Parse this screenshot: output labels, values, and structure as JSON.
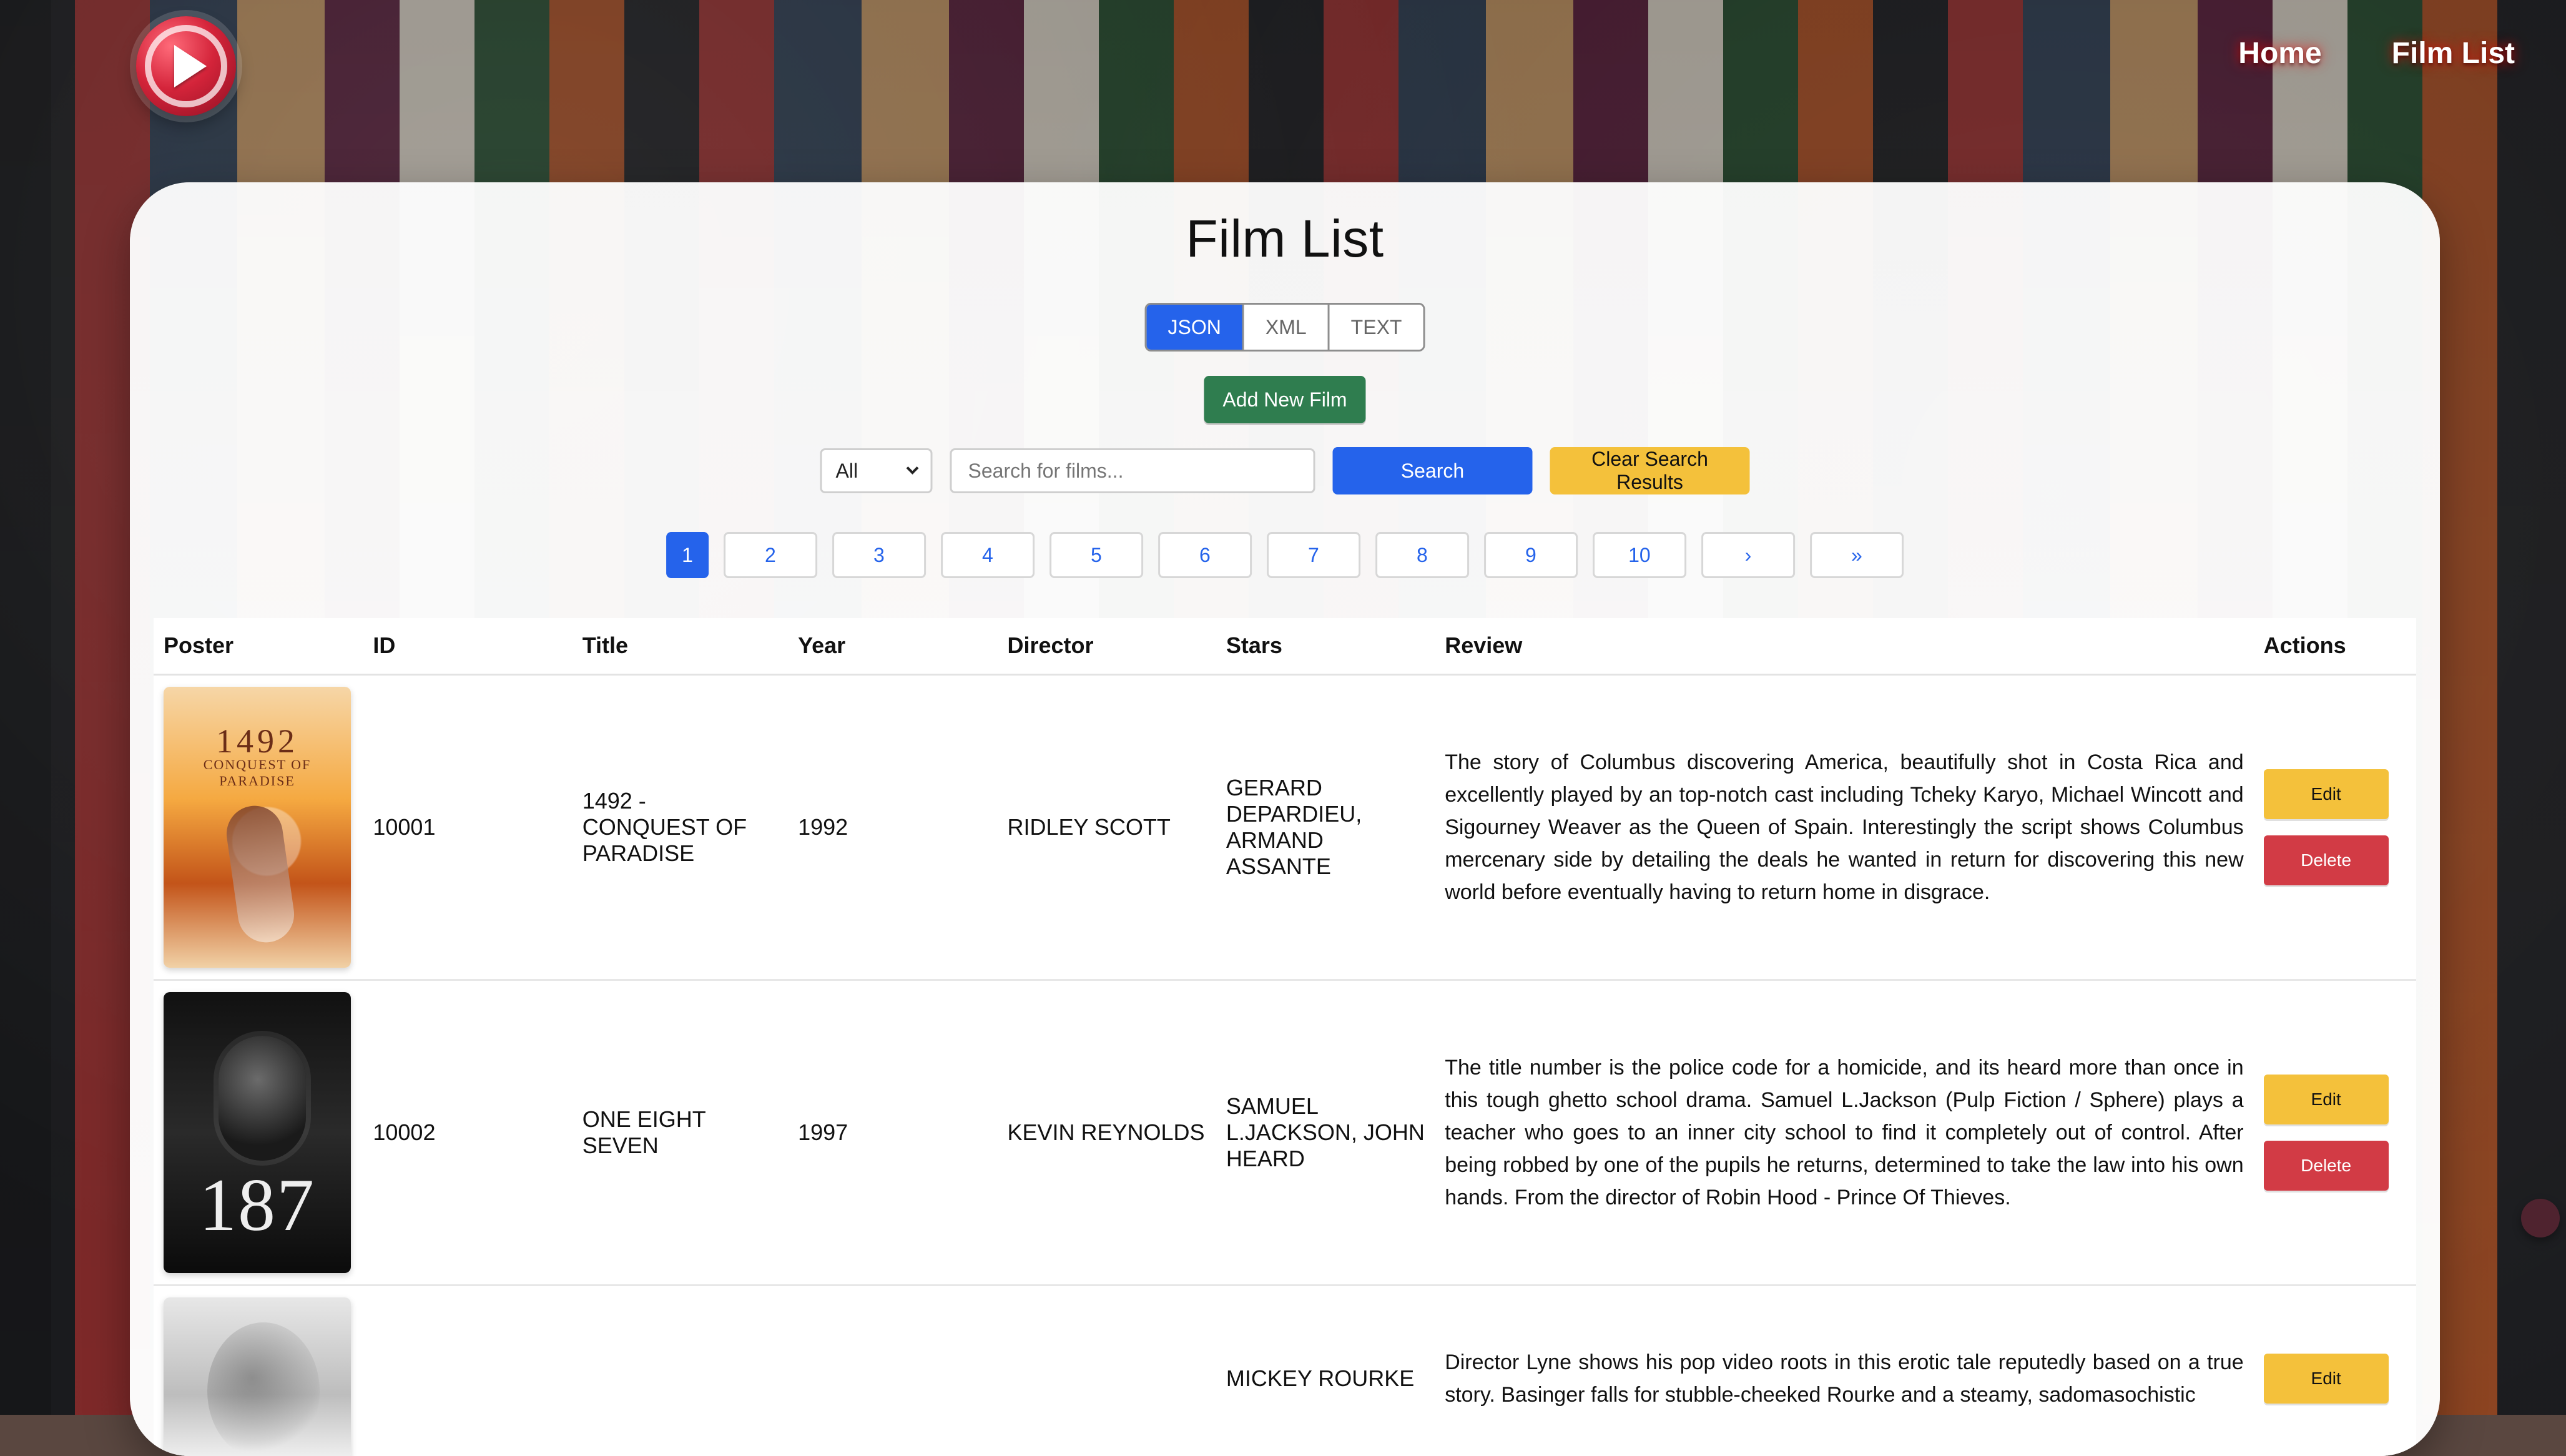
{
  "nav": {
    "logo": "play-icon",
    "links": [
      {
        "label": "Home"
      },
      {
        "label": "Film List"
      }
    ]
  },
  "main": {
    "title": "Film List",
    "format_toggle": {
      "options": [
        "JSON",
        "XML",
        "TEXT"
      ],
      "active": "JSON"
    },
    "add_button": "Add New Film",
    "search": {
      "select_value": "All",
      "placeholder": "Search for films...",
      "search_label": "Search",
      "clear_label": "Clear Search Results"
    },
    "pagination": {
      "items": [
        "1",
        "2",
        "3",
        "4",
        "5",
        "6",
        "7",
        "8",
        "9",
        "10",
        "›",
        "»"
      ],
      "active": "1"
    },
    "table": {
      "headers": [
        "Poster",
        "ID",
        "Title",
        "Year",
        "Director",
        "Stars",
        "Review",
        "Actions"
      ],
      "rows": [
        {
          "id": "10001",
          "title": "1492 - CONQUEST OF PARADISE",
          "year": "1992",
          "director": "RIDLEY SCOTT",
          "stars": "GERARD DEPARDIEU, ARMAND ASSANTE",
          "review": "The story of Columbus discovering America, beautifully shot in Costa Rica and excellently played by an top-notch cast including Tcheky Karyo, Michael Wincott and Sigourney Weaver as the Queen of Spain. Interestingly the script shows Columbus mercenary side by detailing the deals he wanted in return for discovering this new world before eventually having to return home in disgrace.",
          "poster_text_1": "1492",
          "poster_text_2": "CONQUEST OF PARADISE"
        },
        {
          "id": "10002",
          "title": "ONE EIGHT SEVEN",
          "year": "1997",
          "director": "KEVIN REYNOLDS",
          "stars": "SAMUEL L.JACKSON, JOHN HEARD",
          "review": "The title number is the police code for a homicide, and its heard more than once in this tough ghetto school drama. Samuel L.Jackson (Pulp Fiction / Sphere) plays a teacher who goes to an inner city school to find it completely out of control. After being robbed by one of the pupils he returns, determined to take the law into his own hands. From the director of Robin Hood - Prince Of Thieves.",
          "poster_text_1": "187"
        },
        {
          "id": "",
          "title": "",
          "year": "",
          "director": "",
          "stars": "MICKEY ROURKE",
          "review": "Director Lyne shows his pop video roots in this erotic tale reputedly based on a true story. Basinger falls for stubble-cheeked Rourke and a steamy, sadomasochistic",
          "poster_text_1": ""
        }
      ],
      "actions": {
        "edit": "Edit",
        "delete": "Delete"
      }
    }
  }
}
